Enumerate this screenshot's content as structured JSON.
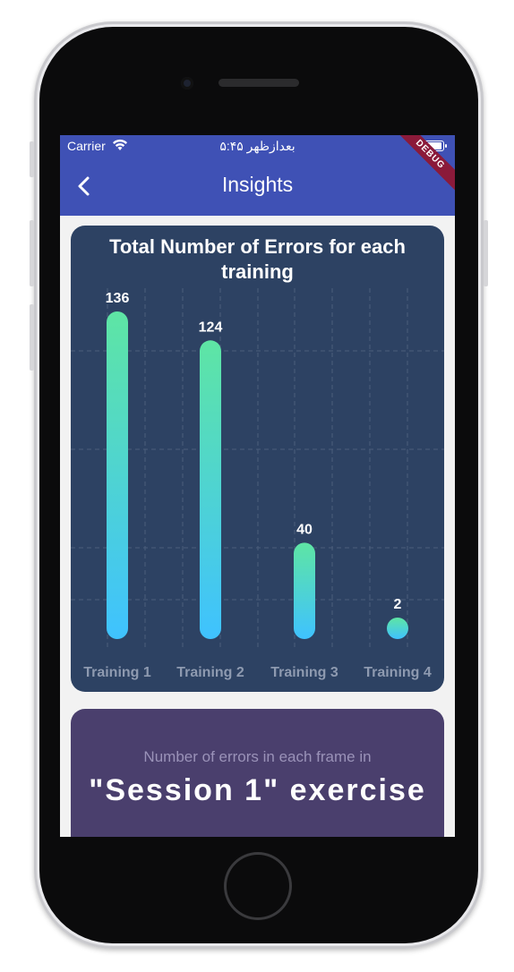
{
  "status_bar": {
    "carrier": "Carrier",
    "time": "۵:۴۵ بعدازظهر"
  },
  "app_bar": {
    "title": "Insights",
    "debug_banner": "DEBUG"
  },
  "chart_card": {
    "chart_data": {
      "type": "bar",
      "title": "Total Number of Errors for each training",
      "categories": [
        "Training 1",
        "Training 2",
        "Training 3",
        "Training 4"
      ],
      "values": [
        136,
        124,
        40,
        2
      ],
      "ylim": [
        0,
        136
      ],
      "grid": true,
      "colors": {
        "bar_top": "#5ee5a4",
        "bar_bottom": "#3fc2ff",
        "background": "#2d4263",
        "grid": "#4a5d7b",
        "label": "#8e9ab0"
      }
    }
  },
  "session_card": {
    "subtitle": "Number of errors in each frame in",
    "heading": "\"Session 1\" exercise"
  }
}
